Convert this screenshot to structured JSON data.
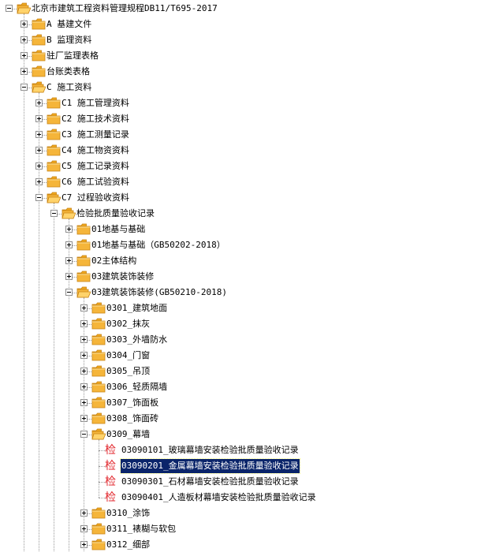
{
  "tree": {
    "nodes": [
      {
        "name": "root",
        "label": "北京市建筑工程资料管理规程DB11/T695-2017",
        "level": 0,
        "type": "folder",
        "state": "expanded"
      },
      {
        "name": "a",
        "label": "A 基建文件",
        "level": 1,
        "type": "folder",
        "state": "collapsed"
      },
      {
        "name": "b",
        "label": "B 监理资料",
        "level": 1,
        "type": "folder",
        "state": "collapsed"
      },
      {
        "name": "zhuchang",
        "label": "驻厂监理表格",
        "level": 1,
        "type": "folder",
        "state": "collapsed"
      },
      {
        "name": "taizhang",
        "label": "台账类表格",
        "level": 1,
        "type": "folder",
        "state": "collapsed"
      },
      {
        "name": "c",
        "label": "C 施工资料",
        "level": 1,
        "type": "folder",
        "state": "expanded"
      },
      {
        "name": "c1",
        "label": "C1 施工管理资料",
        "level": 2,
        "type": "folder",
        "state": "collapsed"
      },
      {
        "name": "c2",
        "label": "C2 施工技术资料",
        "level": 2,
        "type": "folder",
        "state": "collapsed"
      },
      {
        "name": "c3",
        "label": "C3 施工测量记录",
        "level": 2,
        "type": "folder",
        "state": "collapsed"
      },
      {
        "name": "c4",
        "label": "C4 施工物资资料",
        "level": 2,
        "type": "folder",
        "state": "collapsed"
      },
      {
        "name": "c5",
        "label": "C5 施工记录资料",
        "level": 2,
        "type": "folder",
        "state": "collapsed"
      },
      {
        "name": "c6",
        "label": "C6 施工试验资料",
        "level": 2,
        "type": "folder",
        "state": "collapsed"
      },
      {
        "name": "c7",
        "label": "C7 过程验收资料",
        "level": 2,
        "type": "folder",
        "state": "expanded"
      },
      {
        "name": "jianyan",
        "label": "检验批质量验收记录",
        "level": 3,
        "type": "folder",
        "state": "expanded"
      },
      {
        "name": "01dj",
        "label": "01地基与基础",
        "level": 4,
        "type": "folder",
        "state": "collapsed"
      },
      {
        "name": "01dj2018",
        "label": "01地基与基础（GB50202-2018）",
        "level": 4,
        "type": "folder",
        "state": "collapsed"
      },
      {
        "name": "02zt",
        "label": "02主体结构",
        "level": 4,
        "type": "folder",
        "state": "collapsed"
      },
      {
        "name": "03jz",
        "label": "03建筑装饰装修",
        "level": 4,
        "type": "folder",
        "state": "collapsed"
      },
      {
        "name": "03jz2018",
        "label": "03建筑装饰装修(GB50210-2018)",
        "level": 4,
        "type": "folder",
        "state": "expanded"
      },
      {
        "name": "0301",
        "label": "0301_建筑地面",
        "level": 5,
        "type": "folder",
        "state": "collapsed"
      },
      {
        "name": "0302",
        "label": "0302_抹灰",
        "level": 5,
        "type": "folder",
        "state": "collapsed"
      },
      {
        "name": "0303",
        "label": "0303_外墙防水",
        "level": 5,
        "type": "folder",
        "state": "collapsed"
      },
      {
        "name": "0304",
        "label": "0304_门窗",
        "level": 5,
        "type": "folder",
        "state": "collapsed"
      },
      {
        "name": "0305",
        "label": "0305_吊顶",
        "level": 5,
        "type": "folder",
        "state": "collapsed"
      },
      {
        "name": "0306",
        "label": "0306_轻质隔墙",
        "level": 5,
        "type": "folder",
        "state": "collapsed"
      },
      {
        "name": "0307",
        "label": "0307_饰面板",
        "level": 5,
        "type": "folder",
        "state": "collapsed"
      },
      {
        "name": "0308",
        "label": "0308_饰面砖",
        "level": 5,
        "type": "folder",
        "state": "collapsed"
      },
      {
        "name": "0309",
        "label": "0309_幕墙",
        "level": 5,
        "type": "folder",
        "state": "expanded"
      },
      {
        "name": "03090101",
        "label": "03090101_玻璃幕墙安装检验批质量验收记录",
        "level": 6,
        "type": "doc",
        "icon_char": "检"
      },
      {
        "name": "03090201",
        "label": "03090201_金属幕墙安装检验批质量验收记录",
        "level": 6,
        "type": "doc",
        "icon_char": "检",
        "selected": true
      },
      {
        "name": "03090301",
        "label": "03090301_石材幕墙安装检验批质量验收记录",
        "level": 6,
        "type": "doc",
        "icon_char": "检"
      },
      {
        "name": "03090401",
        "label": "03090401_人造板材幕墙安装检验批质量验收记录",
        "level": 6,
        "type": "doc",
        "icon_char": "检"
      },
      {
        "name": "0310",
        "label": "0310_涂饰",
        "level": 5,
        "type": "folder",
        "state": "collapsed"
      },
      {
        "name": "0311",
        "label": "0311_裱糊与软包",
        "level": 5,
        "type": "folder",
        "state": "collapsed"
      },
      {
        "name": "0312",
        "label": "0312_细部",
        "level": 5,
        "type": "folder",
        "state": "collapsed"
      }
    ]
  },
  "colors": {
    "selection_bg": "#0a246a",
    "folder_yellow": "#f5b53a",
    "doc_red": "#e2262c"
  },
  "icons": {
    "folder": "folder-icon",
    "folder_open": "folder-open-icon",
    "doc": "record-document-icon"
  }
}
